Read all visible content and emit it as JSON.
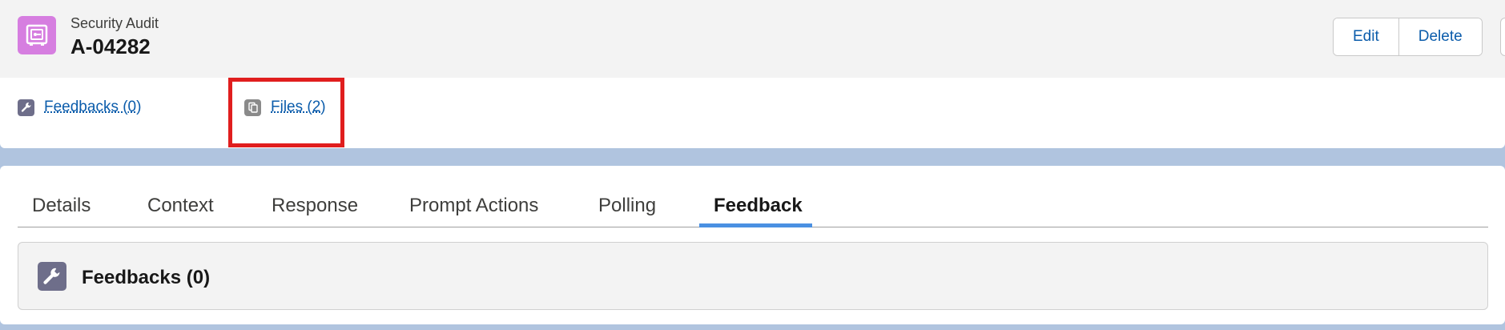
{
  "record": {
    "type_label": "Security Audit",
    "title": "A-04282",
    "icon": "safe-icon",
    "icon_color": "#d67ee0"
  },
  "actions": {
    "edit_label": "Edit",
    "delete_label": "Delete"
  },
  "related_links": [
    {
      "label": "Feedbacks (0)",
      "icon": "wrench-icon",
      "icon_color": "#6e6e8a"
    },
    {
      "label": "Files (2)",
      "icon": "file-icon",
      "icon_color": "#8a8a8a",
      "highlighted": true
    }
  ],
  "tabs": [
    {
      "label": "Details"
    },
    {
      "label": "Context"
    },
    {
      "label": "Response"
    },
    {
      "label": "Prompt Actions"
    },
    {
      "label": "Polling"
    },
    {
      "label": "Feedback",
      "active": true
    }
  ],
  "panel": {
    "title": "Feedbacks (0)",
    "icon": "wrench-icon"
  },
  "colors": {
    "link": "#0b5cab",
    "highlight": "#e01e1e",
    "tab_underline": "#4a90e2"
  }
}
